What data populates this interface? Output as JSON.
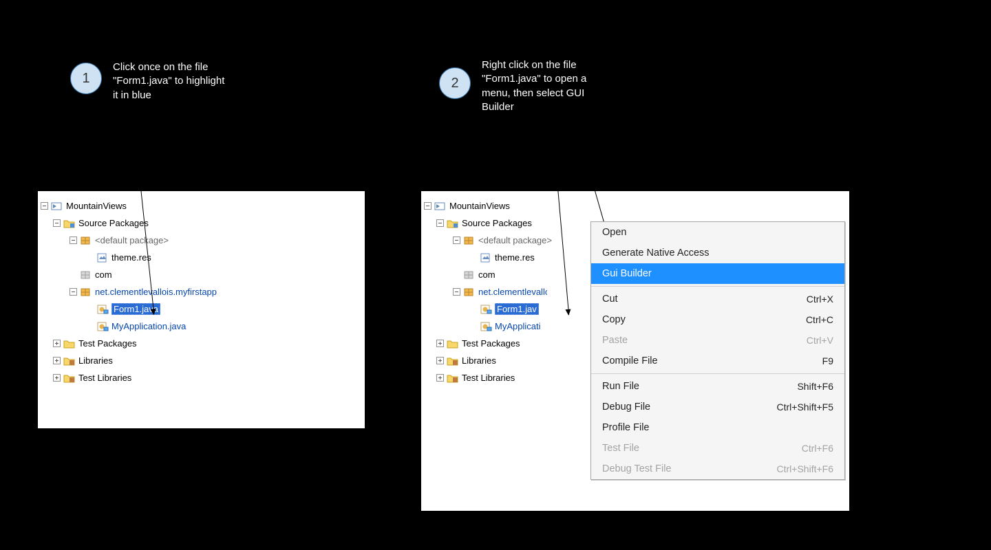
{
  "steps": {
    "circle1": "1",
    "circle2": "2",
    "text1": "Click once on the file\n\"Form1.java\" to highlight\nit in blue",
    "text2": "Right click on the file\n\"Form1.java\" to open a\nmenu, then select GUI\nBuilder"
  },
  "tree": {
    "project": "MountainViews",
    "source_packages": "Source Packages",
    "default_package": "<default package>",
    "theme_res": "theme.res",
    "com": "com",
    "net_pkg": "net.clementlevallois.myfirstapp",
    "form1": "Form1.java",
    "form1_cut": "Form1.jav",
    "myapp": "MyApplication.java",
    "myapp_cut": "MyApplicati",
    "test_packages": "Test Packages",
    "libraries": "Libraries",
    "test_libraries": "Test Libraries"
  },
  "menu": {
    "open": "Open",
    "gen_native": "Generate Native Access",
    "gui_builder": "Gui Builder",
    "cut": "Cut",
    "cut_sc": "Ctrl+X",
    "copy": "Copy",
    "copy_sc": "Ctrl+C",
    "paste": "Paste",
    "paste_sc": "Ctrl+V",
    "compile": "Compile File",
    "compile_sc": "F9",
    "run": "Run File",
    "run_sc": "Shift+F6",
    "debug": "Debug File",
    "debug_sc": "Ctrl+Shift+F5",
    "profile": "Profile File",
    "test": "Test File",
    "test_sc": "Ctrl+F6",
    "debug_test": "Debug Test File",
    "debug_test_sc": "Ctrl+Shift+F6"
  }
}
